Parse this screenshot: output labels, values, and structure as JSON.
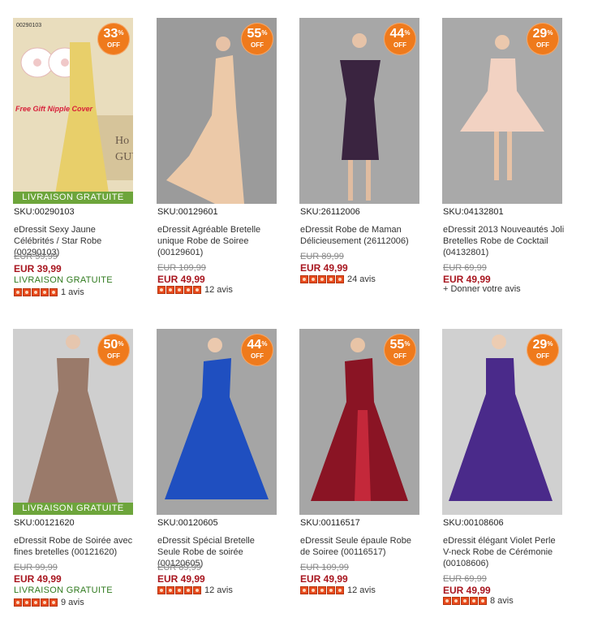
{
  "products": [
    {
      "sku": "SKU:00290103",
      "title": "eDressit Sexy Jaune Célébrités / Star Robe (00290103)",
      "old_price": "EUR 59,99",
      "new_price": "EUR 39,99",
      "discount_pct": "33",
      "off_label": "OFF",
      "free_shipping_banner": "LIVRAISON GRATUITE",
      "free_shipping_text": "LIVRAISON GRATUITE",
      "reviews": "1 avis",
      "stars": 5,
      "image_sku": "00290103",
      "image_caption": "Free Gift Nipple Cover",
      "dress_color": "#e8cf6a"
    },
    {
      "sku": "SKU:00129601",
      "title": "eDressit Agréable Bretelle unique Robe de Soiree (00129601)",
      "old_price": "EUR 109,99",
      "new_price": "EUR 49,99",
      "discount_pct": "55",
      "off_label": "OFF",
      "reviews": "12 avis",
      "stars": 5,
      "dress_color": "#ecc9a8"
    },
    {
      "sku": "SKU:26112006",
      "title": "eDressit Robe de Maman Délicieusement (26112006)",
      "old_price": "EUR 89,99",
      "new_price": "EUR 49,99",
      "discount_pct": "44",
      "off_label": "OFF",
      "reviews": "24 avis",
      "stars": 5,
      "dress_color": "#3a2440"
    },
    {
      "sku": "SKU:04132801",
      "title": "eDressit 2013 Nouveautés Joli Bretelles Robe de Cocktail (04132801)",
      "old_price": "EUR 69,99",
      "new_price": "EUR 49,99",
      "discount_pct": "29",
      "off_label": "OFF",
      "give_review": "+ Donner votre avis",
      "dress_color": "#f2d2c2"
    },
    {
      "sku": "SKU:00121620",
      "title": "eDressit Robe de Soirée avec fines bretelles (00121620)",
      "old_price": "EUR 99,99",
      "new_price": "EUR 49,99",
      "discount_pct": "50",
      "off_label": "OFF",
      "free_shipping_banner": "LIVRAISON GRATUITE",
      "free_shipping_text": "LIVRAISON GRATUITE",
      "reviews": "9 avis",
      "stars": 5,
      "dress_color": "#9a7a6a"
    },
    {
      "sku": "SKU:00120605",
      "title": "eDressit Spécial Bretelle Seule Robe de soirée (00120605)",
      "old_price": "EUR 89,99",
      "new_price": "EUR 49,99",
      "discount_pct": "44",
      "off_label": "OFF",
      "reviews": "12 avis",
      "stars": 5,
      "dress_color": "#1f4fc0"
    },
    {
      "sku": "SKU:00116517",
      "title": "eDressit Seule épaule Robe de Soiree (00116517)",
      "old_price": "EUR 109,99",
      "new_price": "EUR 49,99",
      "discount_pct": "55",
      "off_label": "OFF",
      "reviews": "12 avis",
      "stars": 5,
      "dress_color": "#8a1424"
    },
    {
      "sku": "SKU:00108606",
      "title": "eDressit élégant Violet Perle V-neck Robe de Cérémonie (00108606)",
      "old_price": "EUR 69,99",
      "new_price": "EUR 49,99",
      "discount_pct": "29",
      "off_label": "OFF",
      "reviews": "8 avis",
      "stars": 5,
      "dress_color": "#4a2a8a"
    }
  ]
}
